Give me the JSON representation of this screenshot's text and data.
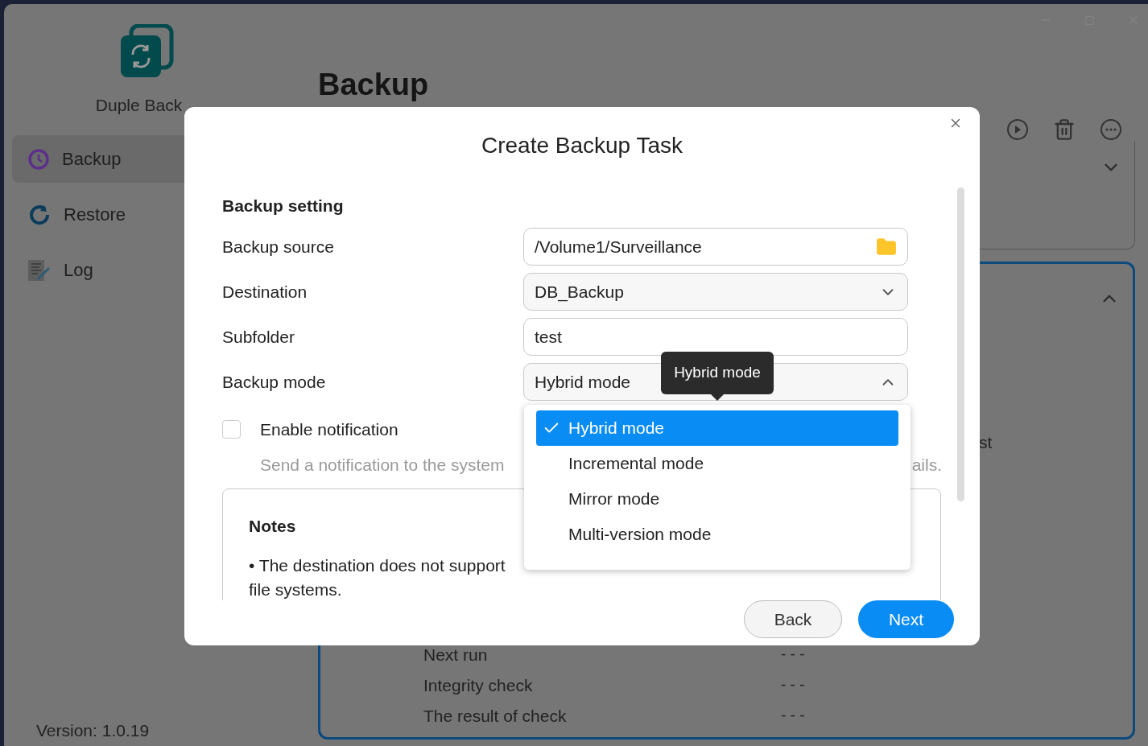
{
  "app": {
    "name": "Duple Back",
    "version": "Version: 1.0.19"
  },
  "sidebar": {
    "items": [
      {
        "label": "Backup",
        "selected": true
      },
      {
        "label": "Restore",
        "selected": false
      },
      {
        "label": "Log",
        "selected": false
      }
    ]
  },
  "main": {
    "title": "Backup",
    "card_fragment": "st",
    "details": [
      {
        "label": "Next run",
        "value": "- - -"
      },
      {
        "label": "Integrity check",
        "value": "- - -"
      },
      {
        "label": "The result of check",
        "value": "- - -"
      }
    ]
  },
  "dialog": {
    "title": "Create Backup Task",
    "section": "Backup setting",
    "fields": [
      {
        "kind": "path",
        "label": "Backup source",
        "value": "/Volume1/Surveillance"
      },
      {
        "kind": "select",
        "label": "Destination",
        "value": "DB_Backup",
        "expanded": false
      },
      {
        "kind": "text",
        "label": "Subfolder",
        "value": "test"
      },
      {
        "kind": "select",
        "label": "Backup mode",
        "value": "Hybrid mode",
        "expanded": true
      }
    ],
    "notification": {
      "label": "Enable notification",
      "checked": false,
      "description_start": "Send a notification to the system",
      "description_end": "ails."
    },
    "notes": {
      "title": "Notes",
      "lines": [
        "• The destination does not support",
        "file systems."
      ]
    },
    "tooltip": "Hybrid mode",
    "options": [
      {
        "label": "Hybrid mode",
        "selected": true
      },
      {
        "label": "Incremental mode",
        "selected": false
      },
      {
        "label": "Mirror mode",
        "selected": false
      },
      {
        "label": "Multi-version mode",
        "selected": false
      }
    ],
    "buttons": [
      {
        "label": "Back",
        "kind": "secondary"
      },
      {
        "label": "Next",
        "kind": "primary"
      }
    ]
  }
}
